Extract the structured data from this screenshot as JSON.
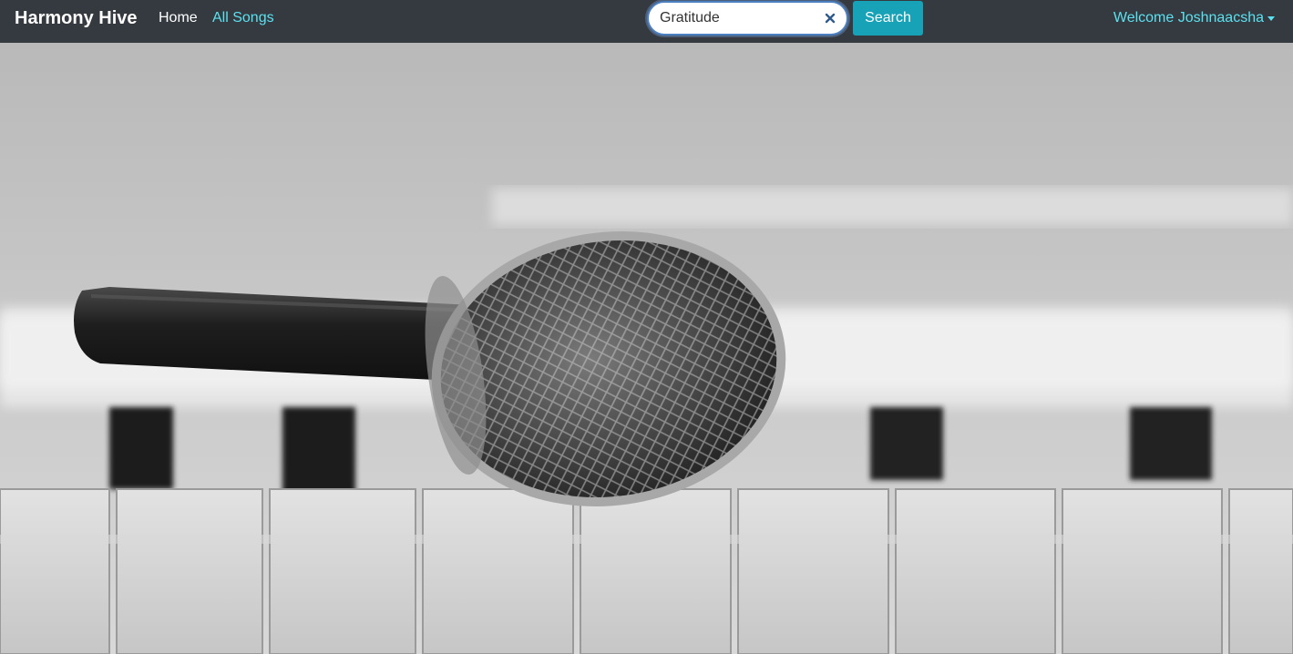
{
  "navbar": {
    "brand": "Harmony Hive",
    "links": [
      {
        "label": "Home"
      },
      {
        "label": "All Songs"
      }
    ],
    "search": {
      "value": "Gratitude",
      "button_label": "Search"
    },
    "user_menu": {
      "label": "Welcome Joshnaacsha"
    }
  },
  "hero": {
    "icon": "microphone-on-piano-image"
  },
  "colors": {
    "navbar_bg": "#343a40",
    "link_accent": "#5ce1f0",
    "button_bg": "#17a2b8"
  }
}
